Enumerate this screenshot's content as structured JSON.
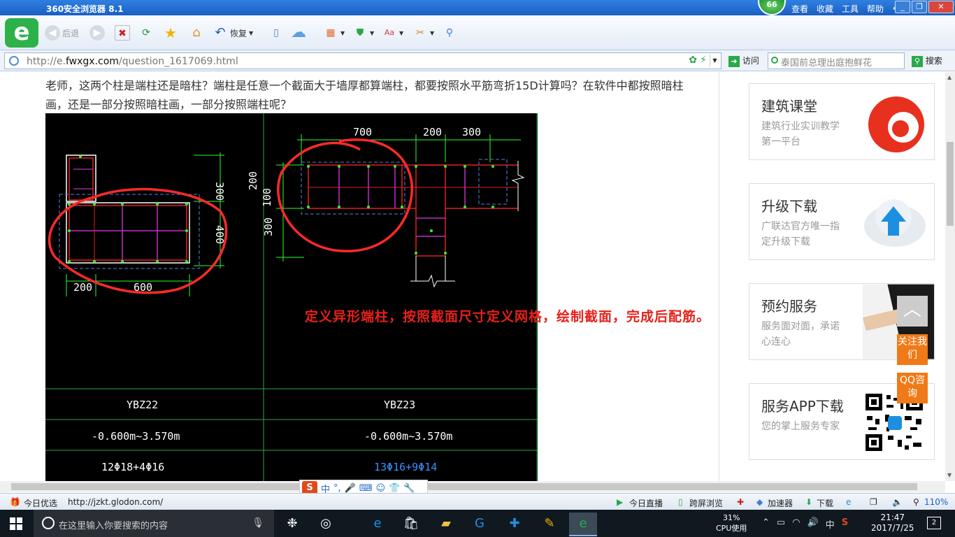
{
  "window": {
    "title": "360安全浏览器 8.1",
    "badge": "66",
    "menu": [
      "查看",
      "收藏",
      "工具",
      "帮助"
    ]
  },
  "toolbar": {
    "back_label": "后退",
    "restore_label": "恢复"
  },
  "address": {
    "url_prefix": "http://e.",
    "url_domain": "fwxgx.com",
    "url_path": "/question_1617069.html",
    "goto_label": "访问",
    "search_placeholder": "泰国前总理出庭抱鲜花",
    "search_btn": "搜索"
  },
  "question": {
    "text": "老师，这两个柱是端柱还是暗柱？端柱是任意一个截面大于墙厚都算端柱，都要按照水平筋弯折15D计算吗？在软件中都按照暗柱画，还是一部分按照暗柱画，一部分按照端柱呢？"
  },
  "drawing": {
    "left_dims": {
      "top": "300",
      "right": "400",
      "bottom_left": "200",
      "bottom_right": "600"
    },
    "right_dims": {
      "top_left": "700",
      "top_mid": "200",
      "top_right": "300",
      "left_top": "200",
      "left_mid": "100",
      "left_bottom": "300"
    },
    "annotation": "定义异形端柱，按照截面尺寸定义网格，绘制截面，完成后配筋。",
    "table": [
      {
        "left": "YBZ22",
        "right": "YBZ23"
      },
      {
        "left": "-0.600m~3.570m",
        "right": "-0.600m~3.570m"
      },
      {
        "left": "12Φ18+4Φ16",
        "right": "13Φ16+9Φ14"
      }
    ]
  },
  "sidebar": {
    "cards": [
      {
        "title": "建筑课堂",
        "sub": "建筑行业实训教学第一平台"
      },
      {
        "title": "升级下载",
        "sub": "广联达官方唯一指定升级下载"
      },
      {
        "title": "预约服务",
        "sub": "服务面对面，承诺心连心"
      },
      {
        "title": "服务APP下载",
        "sub": "您的掌上服务专家"
      }
    ],
    "follow": "关注我们",
    "qq": "QQ咨询"
  },
  "statusbar": {
    "today": "今日优选",
    "url": "http://jzkt.glodon.com/",
    "live": "今日直播",
    "cross": "跨屏浏览",
    "accel": "加速器",
    "download": "下载",
    "zoom": "110%"
  },
  "taskbar": {
    "search_placeholder": "在这里输入你要搜索的内容",
    "cpu_pct": "31%",
    "cpu_label": "CPU使用",
    "ime": "中",
    "time": "21:47",
    "date": "2017/7/25",
    "notif": "2"
  },
  "colors": {
    "annotation": "#e8201a",
    "table_right_value": "#3a8fff"
  }
}
